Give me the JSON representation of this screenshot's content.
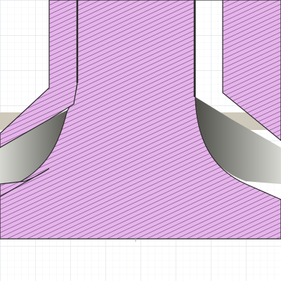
{
  "viewport": {
    "background_color": "#ffffff",
    "grid": {
      "visible": true,
      "minor_color": "#e9edf2",
      "major_color": "#d2d9e2"
    }
  },
  "section_view": {
    "hatch_fill_color": "#e6b4ea",
    "hatch_line_color": "#5a3a6a",
    "edge_color": "#2a2a2a",
    "interior_shade_light": "#d8d8d2",
    "interior_shade_dark": "#4e4e48",
    "background_body_color": "#cfc9bc"
  },
  "origin_marker": {
    "icon": "origin-tick-icon",
    "color": "#9aa4b0"
  }
}
